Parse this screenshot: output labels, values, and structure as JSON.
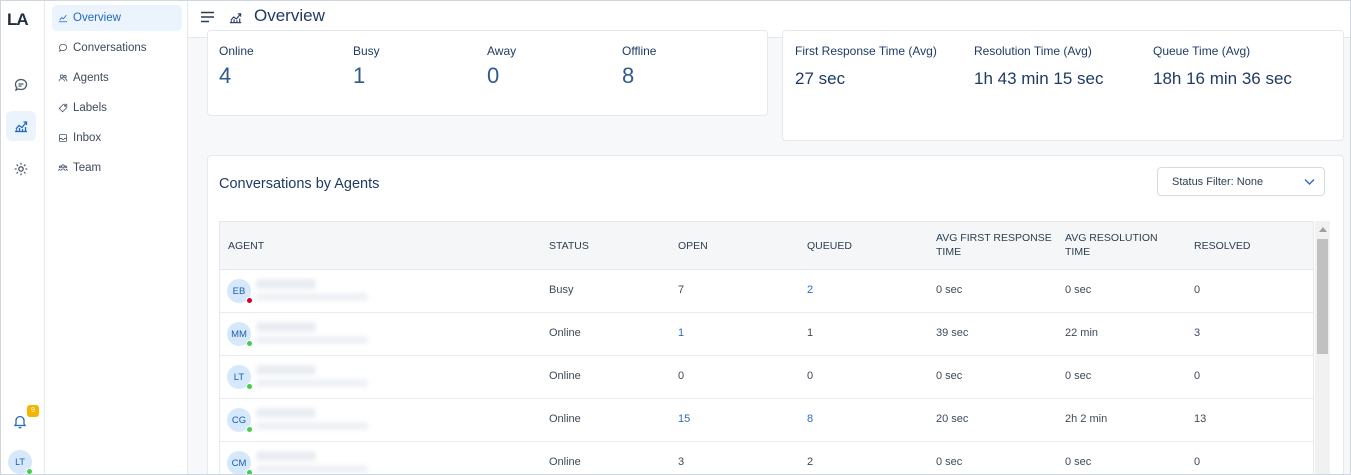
{
  "brand": {
    "logo": "LA"
  },
  "rail": {
    "notification_count": "9",
    "user_initials": "LT"
  },
  "nav": {
    "items": [
      {
        "label": "Overview",
        "icon": "chart-line-icon"
      },
      {
        "label": "Conversations",
        "icon": "chat-icon"
      },
      {
        "label": "Agents",
        "icon": "agents-icon"
      },
      {
        "label": "Labels",
        "icon": "tag-icon"
      },
      {
        "label": "Inbox",
        "icon": "inbox-icon"
      },
      {
        "label": "Team",
        "icon": "team-icon"
      }
    ]
  },
  "header": {
    "title": "Overview"
  },
  "agent_status": {
    "online": {
      "label": "Online",
      "value": "4"
    },
    "busy": {
      "label": "Busy",
      "value": "1"
    },
    "away": {
      "label": "Away",
      "value": "0"
    },
    "offline": {
      "label": "Offline",
      "value": "8"
    }
  },
  "metrics": {
    "first_response": {
      "label": "First Response Time (Avg)",
      "value": "27 sec"
    },
    "resolution": {
      "label": "Resolution Time (Avg)",
      "value": "1h 43 min 15 sec"
    },
    "queue": {
      "label": "Queue Time (Avg)",
      "value": "18h 16 min 36 sec"
    }
  },
  "section": {
    "title": "Conversations by Agents",
    "filter_label": "Status Filter: None"
  },
  "table": {
    "headers": {
      "agent": "AGENT",
      "status": "STATUS",
      "open": "OPEN",
      "queued": "QUEUED",
      "avg_first_response_1": "AVG FIRST RESPONSE",
      "avg_first_response_2": "TIME",
      "avg_resolution_1": "AVG RESOLUTION",
      "avg_resolution_2": "TIME",
      "resolved": "RESOLVED"
    },
    "rows": [
      {
        "initials": "EB",
        "status": "Busy",
        "status_color": "#d0021b",
        "open": "7",
        "queued": "2",
        "first_response": "0 sec",
        "resolution": "0 sec",
        "resolved": "0"
      },
      {
        "initials": "MM",
        "status": "Online",
        "status_color": "#44ce4b",
        "open": "1",
        "queued": "1",
        "first_response": "39 sec",
        "resolution": "22 min",
        "resolved": "3"
      },
      {
        "initials": "LT",
        "status": "Online",
        "status_color": "#44ce4b",
        "open": "0",
        "queued": "0",
        "first_response": "0 sec",
        "resolution": "0 sec",
        "resolved": "0"
      },
      {
        "initials": "CG",
        "status": "Online",
        "status_color": "#44ce4b",
        "open": "15",
        "queued": "8",
        "first_response": "20 sec",
        "resolution": "2h 2 min",
        "resolved": "13"
      },
      {
        "initials": "CM",
        "status": "Online",
        "status_color": "#44ce4b",
        "open": "3",
        "queued": "2",
        "first_response": "0 sec",
        "resolution": "0 sec",
        "resolved": "0"
      }
    ]
  },
  "colors": {
    "accent": "#1f6bbf",
    "online": "#44ce4b",
    "busy": "#d0021b",
    "badge": "#f5b400"
  }
}
